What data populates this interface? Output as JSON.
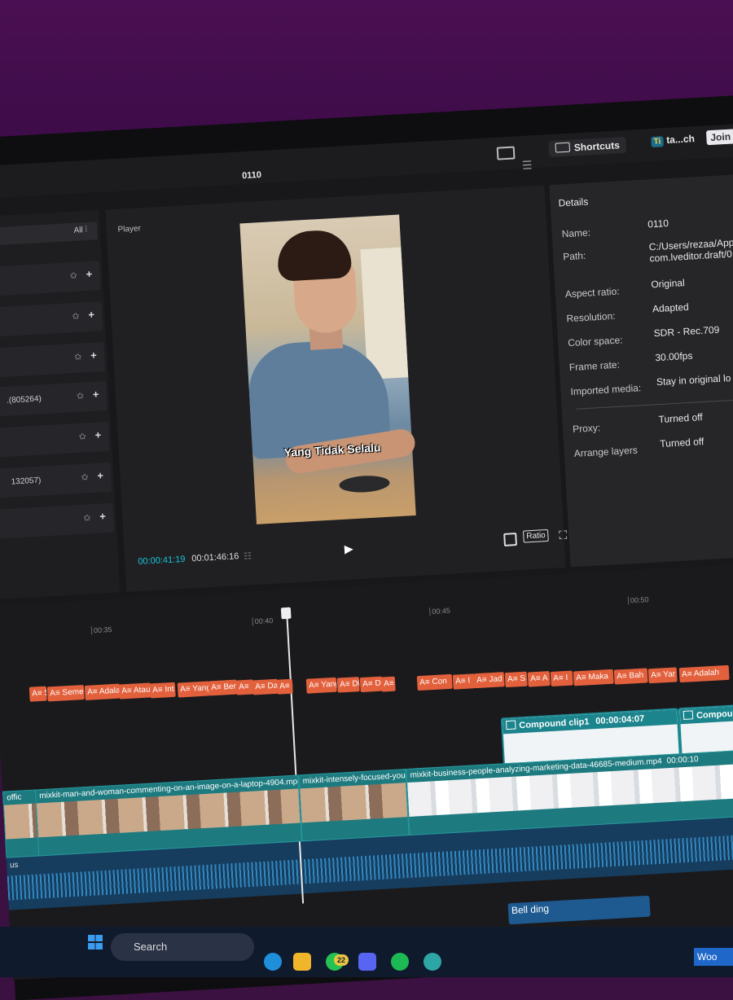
{
  "topbar": {
    "shortcuts_label": "Shortcuts",
    "account_label": "ta...ch",
    "account_badge": "Ti",
    "join_label": "Join"
  },
  "project": {
    "title": "0110"
  },
  "media": {
    "filter_label": "All",
    "rows": [
      {
        "label": ""
      },
      {
        "label": ""
      },
      {
        "label": ""
      },
      {
        "label": ".(805264)"
      },
      {
        "label": ""
      },
      {
        "label": "132057)"
      },
      {
        "label": ""
      }
    ]
  },
  "player": {
    "tab_label": "Player",
    "caption": "Yang Tidak Selalu",
    "current_time": "00:00:41:19",
    "duration": "00:01:46:16",
    "ratio_label": "Ratio"
  },
  "details": {
    "title": "Details",
    "fields": [
      {
        "label": "Name:",
        "value": "0110"
      },
      {
        "label": "Path:",
        "value": "C:/Users/rezaa/App"
      },
      {
        "label": "",
        "value": "com.lveditor.draft/0"
      },
      {
        "label": "Aspect ratio:",
        "value": "Original"
      },
      {
        "label": "Resolution:",
        "value": "Adapted"
      },
      {
        "label": "Color space:",
        "value": "SDR - Rec.709"
      },
      {
        "label": "Frame rate:",
        "value": "30.00fps"
      },
      {
        "label": "Imported media:",
        "value": "Stay in original lo"
      },
      {
        "label": "Proxy:",
        "value": "Turned off"
      },
      {
        "label": "Arrange layers",
        "value": "Turned off"
      }
    ]
  },
  "timeline": {
    "ruler": [
      "00:35",
      "00:40",
      "00:45",
      "00:50"
    ],
    "text_clips": [
      "A≡ S",
      "A≡ Semer",
      "A≡ Adalah",
      "A≡ Atau",
      "A≡ Int",
      "A≡ Yang",
      "A≡ Beri",
      "A≡",
      "A≡ Da",
      "A≡ Di",
      "A≡ Yang",
      "A≡ Di",
      "A≡ De",
      "A≡ A",
      "A≡ Con",
      "A≡ I",
      "A≡ Jad",
      "A≡ S",
      "A≡ A",
      "A≡ I",
      "A≡ Maka",
      "A≡ Bah",
      "A≡ Yar",
      "A≡ Adalah",
      "A≡"
    ],
    "compound": [
      {
        "label": "Compound clip1",
        "duration": "00:00:04:07"
      },
      {
        "label": "Compound"
      }
    ],
    "video_clips": [
      {
        "name": "offic"
      },
      {
        "name": "mixkit-man-and-woman-commenting-on-an-image-on-a-laptop-4904.mp4"
      },
      {
        "name": "mixkit-intensely-focused-you"
      },
      {
        "name": "mixkit-business-people-analyzing-marketing-data-46685-medium.mp4",
        "duration": "00:00:10"
      }
    ],
    "audio_label": "us",
    "bell_label": "Bell ding"
  },
  "taskbar": {
    "search_label": "Search",
    "badge_count": "22",
    "woo_label": "Woo"
  },
  "colors": {
    "accent": "#19c3d8",
    "text_clip": "#e2603c",
    "compound": "#1b848c",
    "wall": "#4a0f52"
  }
}
